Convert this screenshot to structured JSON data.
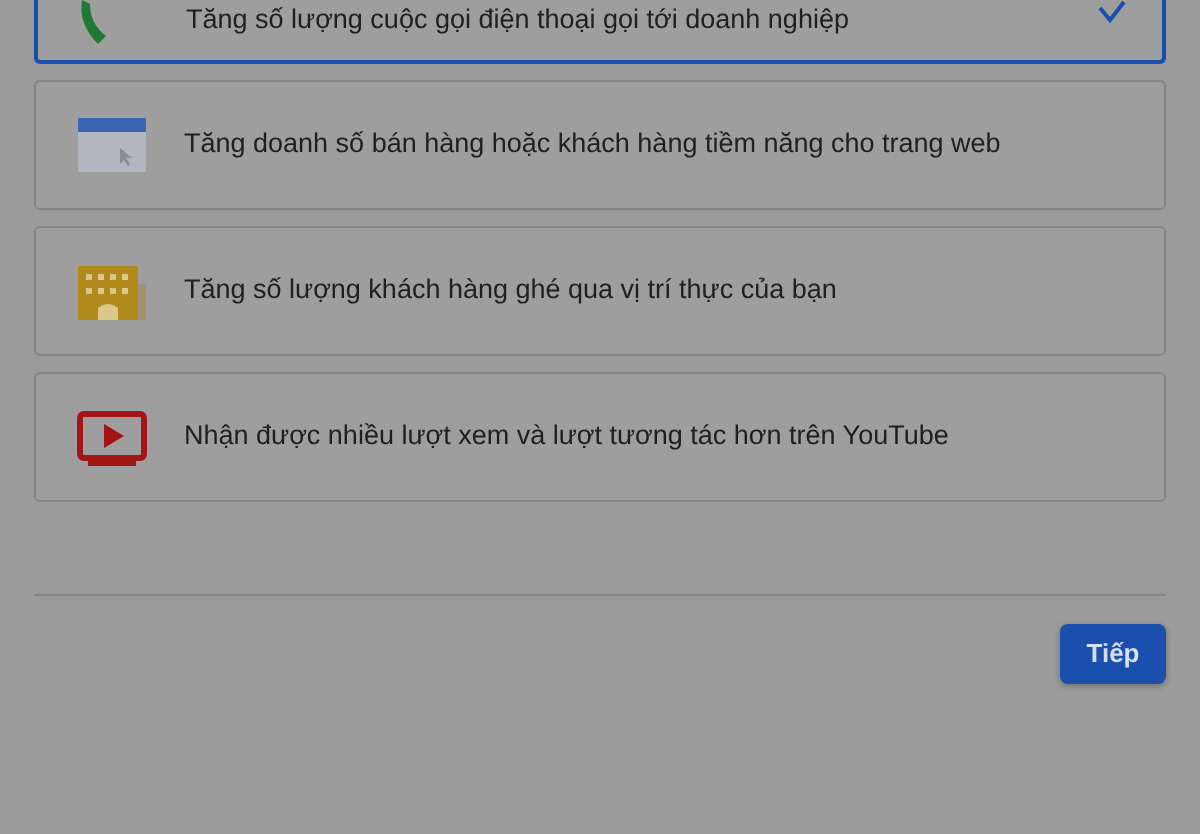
{
  "options": [
    {
      "kind": "phone",
      "label": "Tăng số lượng cuộc gọi điện thoại gọi tới doanh nghiệp",
      "selected": true
    },
    {
      "kind": "web",
      "label": "Tăng doanh số bán hàng hoặc khách hàng tiềm năng cho trang web",
      "selected": false
    },
    {
      "kind": "store",
      "label": "Tăng số lượng khách hàng ghé qua vị trí thực của bạn",
      "selected": false
    },
    {
      "kind": "video",
      "label": "Nhận được nhiều lượt xem và lượt tương tác hơn trên YouTube",
      "selected": false
    }
  ],
  "next_button": "Tiếp"
}
